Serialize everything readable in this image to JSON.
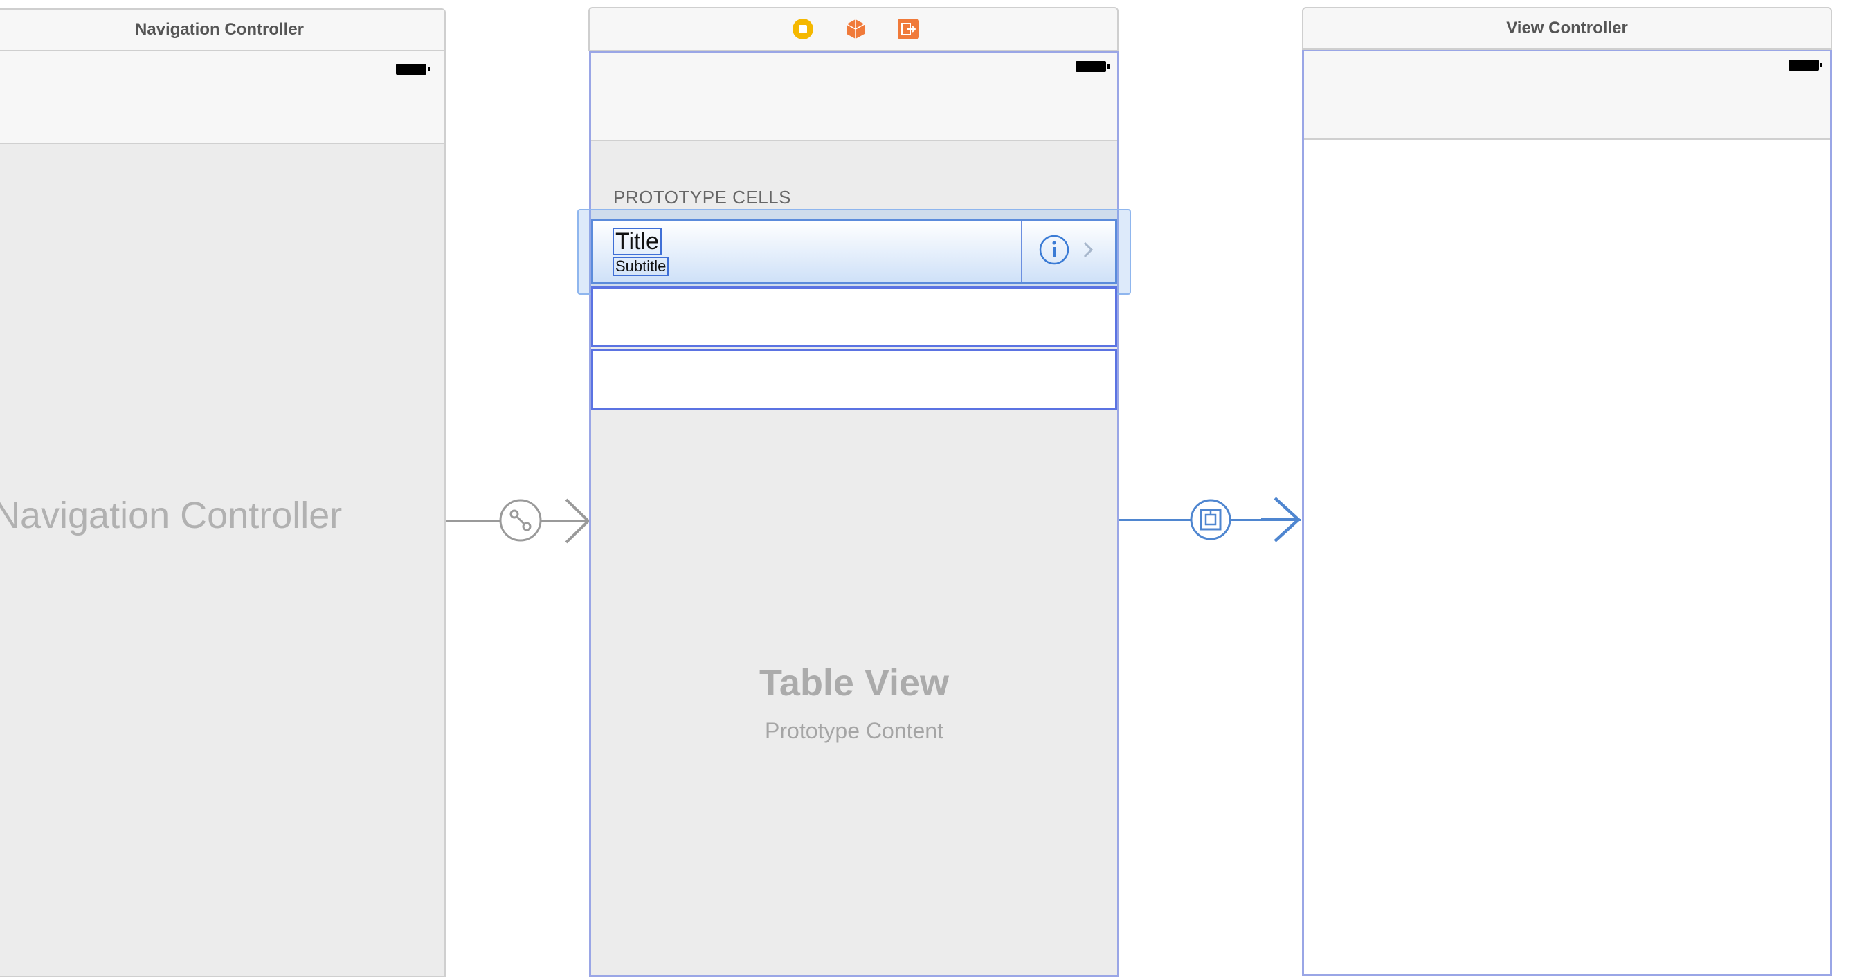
{
  "navigation_controller": {
    "scene_title": "Navigation Controller",
    "placeholder_label": "Navigation Controller"
  },
  "table_view_controller": {
    "dock_icons": [
      "view-controller-icon",
      "first-responder-icon",
      "exit-icon"
    ],
    "section_header": "PROTOTYPE CELLS",
    "prototype_cell": {
      "title": "Title",
      "subtitle": "Subtitle",
      "accessory": "detail-disclosure-button"
    },
    "placeholder_title": "Table View",
    "placeholder_subtitle": "Prototype Content"
  },
  "view_controller": {
    "scene_title": "View Controller"
  },
  "segues": [
    {
      "kind": "root-view-controller-relationship",
      "icon": "relationship-segue-icon"
    },
    {
      "kind": "show",
      "icon": "show-segue-icon"
    }
  ],
  "colors": {
    "selection_blue": "#5b8bdb",
    "segue_blue": "#4f86d0",
    "segue_gray": "#9a9a9a",
    "placeholder_text": "#ababab",
    "dock_yellow": "#f5b800",
    "dock_orange": "#f07a3a"
  }
}
